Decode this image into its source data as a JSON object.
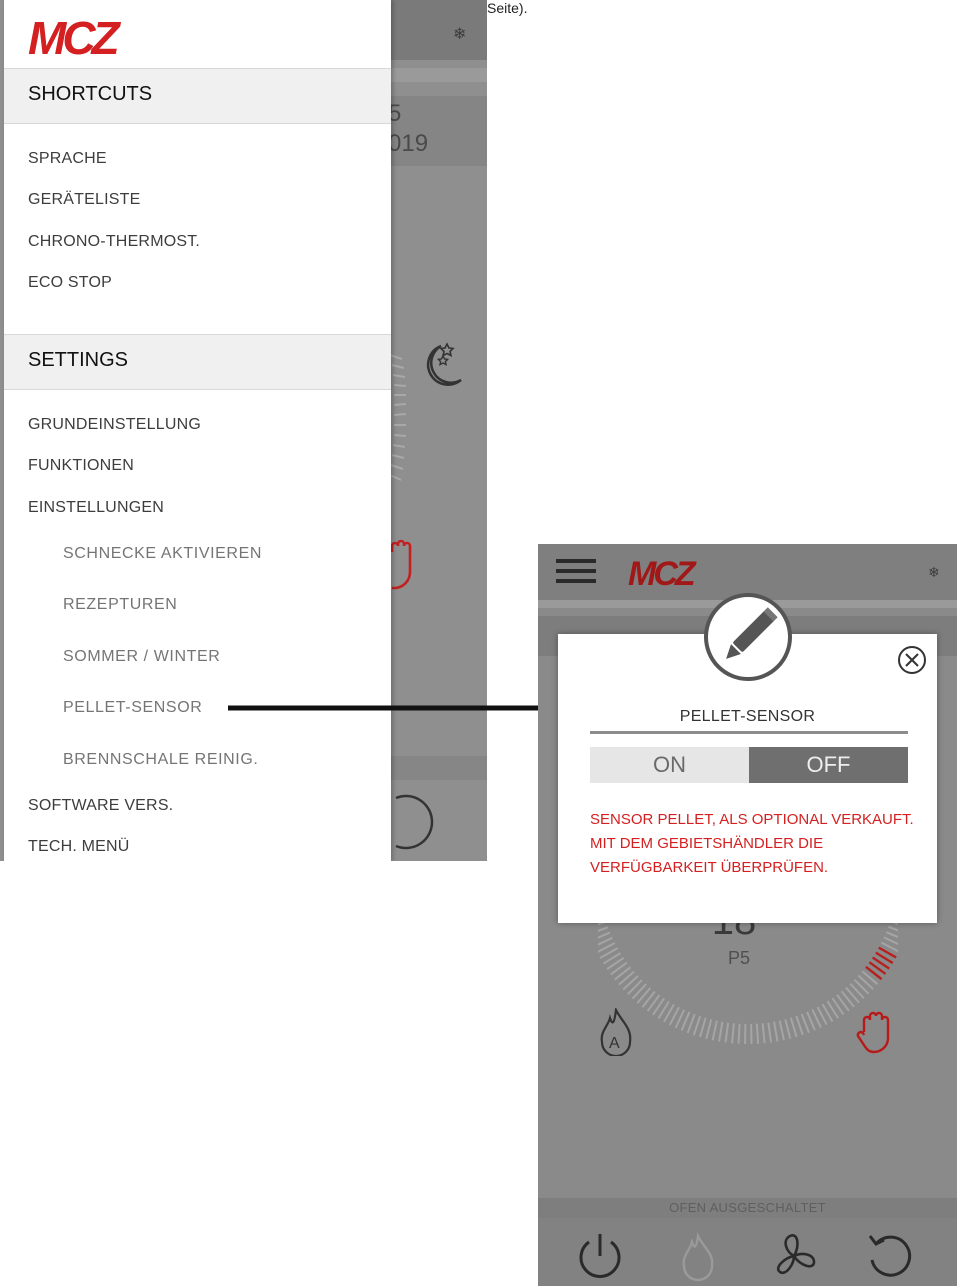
{
  "caption": "Seite).",
  "left": {
    "background_texts": [
      "5",
      "019"
    ],
    "drawer": {
      "logo_text": "MCZ",
      "shortcuts_header": "SHORTCUTS",
      "shortcuts": [
        "SPRACHE",
        "GERÄTELISTE",
        "CHRONO-THERMOST.",
        "ECO STOP"
      ],
      "settings_header": "SETTINGS",
      "settings": [
        "GRUNDEINSTELLUNG",
        "FUNKTIONEN",
        "EINSTELLUNGEN"
      ],
      "sub_settings": [
        "SCHNECKE AKTIVIEREN",
        "REZEPTUREN",
        "SOMMER / WINTER",
        "PELLET-SENSOR",
        "BRENNSCHALE REINIG."
      ],
      "footer_items": [
        "SOFTWARE VERS.",
        "TECH. MENÜ"
      ]
    },
    "icons": [
      "snowflake-icon",
      "moon-star-icon",
      "hand-icon",
      "refresh-icon"
    ]
  },
  "right": {
    "logo_text": "MCZ",
    "temperature": "18",
    "power_level": "P5",
    "status": "OFEN AUSGESCHALTET",
    "icons": [
      "hamburger-icon",
      "snowflake-icon",
      "flame-auto-icon",
      "hand-icon",
      "power-icon",
      "flame-icon",
      "fan-icon",
      "refresh-icon"
    ]
  },
  "dialog": {
    "title": "PELLET-SENSOR",
    "toggle_on": "ON",
    "toggle_off": "OFF",
    "selected": "OFF",
    "message_lines": [
      "SENSOR PELLET, ALS OPTIONAL VERKAUFT.",
      "MIT DEM GEBIETSHÄNDLER DIE",
      "VERFÜGBARKEIT ÜBERPRÜFEN."
    ],
    "icons": [
      "edit-pencil-icon",
      "close-circle-icon"
    ]
  },
  "colors": {
    "brand_red": "#d42020",
    "overlay_gray": "#8a8a8a",
    "toggle_selected": "#6f6f6f"
  }
}
